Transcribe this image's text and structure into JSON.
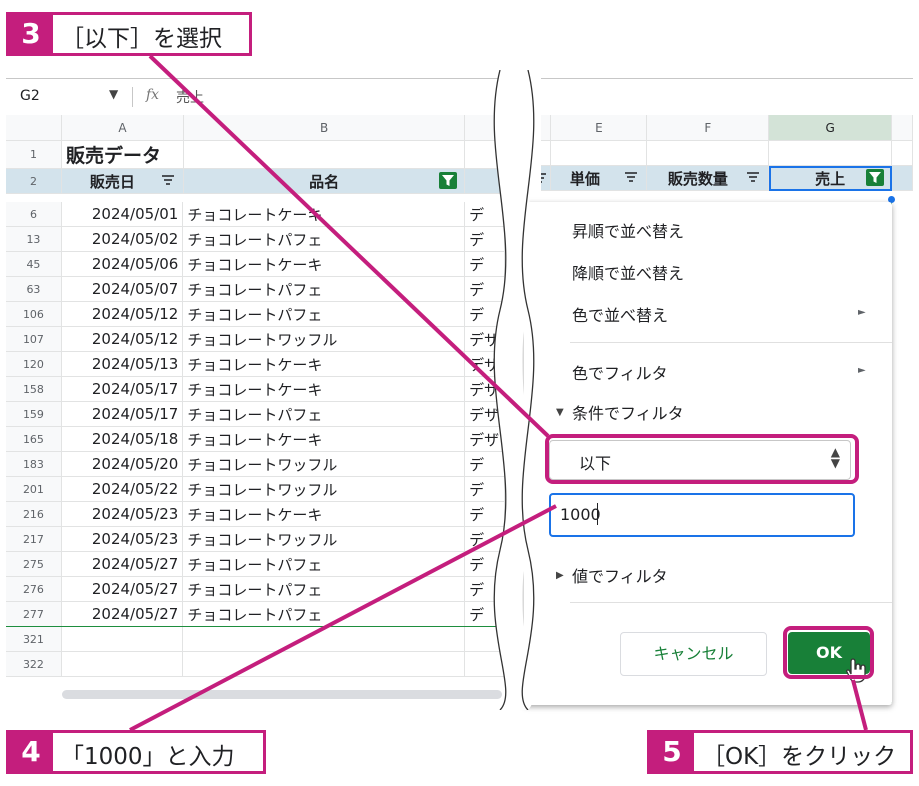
{
  "formula_bar": {
    "cell_ref": "G2",
    "fx": "fx",
    "value": "売上"
  },
  "columns_left": [
    "A",
    "B"
  ],
  "title_row": {
    "row": "1",
    "title": "販売データ"
  },
  "header_row": {
    "row": "2",
    "sale_date": "販売日",
    "product": "品名"
  },
  "rows": [
    {
      "row": "6",
      "date": "2024/05/01",
      "name": "チョコレートケーキ",
      "cat": "デ"
    },
    {
      "row": "13",
      "date": "2024/05/02",
      "name": "チョコレートパフェ",
      "cat": "デ"
    },
    {
      "row": "45",
      "date": "2024/05/06",
      "name": "チョコレートケーキ",
      "cat": "デ"
    },
    {
      "row": "63",
      "date": "2024/05/07",
      "name": "チョコレートパフェ",
      "cat": "デ"
    },
    {
      "row": "106",
      "date": "2024/05/12",
      "name": "チョコレートパフェ",
      "cat": "デ"
    },
    {
      "row": "107",
      "date": "2024/05/12",
      "name": "チョコレートワッフル",
      "cat": "デザ"
    },
    {
      "row": "120",
      "date": "2024/05/13",
      "name": "チョコレートケーキ",
      "cat": "デザ"
    },
    {
      "row": "158",
      "date": "2024/05/17",
      "name": "チョコレートケーキ",
      "cat": "デザ"
    },
    {
      "row": "159",
      "date": "2024/05/17",
      "name": "チョコレートパフェ",
      "cat": "デザ"
    },
    {
      "row": "165",
      "date": "2024/05/18",
      "name": "チョコレートケーキ",
      "cat": "デザ"
    },
    {
      "row": "183",
      "date": "2024/05/20",
      "name": "チョコレートワッフル",
      "cat": "デ"
    },
    {
      "row": "201",
      "date": "2024/05/22",
      "name": "チョコレートワッフル",
      "cat": "デ"
    },
    {
      "row": "216",
      "date": "2024/05/23",
      "name": "チョコレートケーキ",
      "cat": "デ"
    },
    {
      "row": "217",
      "date": "2024/05/23",
      "name": "チョコレートワッフル",
      "cat": "デ"
    },
    {
      "row": "275",
      "date": "2024/05/27",
      "name": "チョコレートパフェ",
      "cat": "デ"
    },
    {
      "row": "276",
      "date": "2024/05/27",
      "name": "チョコレートパフェ",
      "cat": "デ"
    },
    {
      "row": "277",
      "date": "2024/05/27",
      "name": "チョコレートパフェ",
      "cat": "デ"
    }
  ],
  "empty_rows": [
    "321",
    "322"
  ],
  "columns_right": [
    "E",
    "F",
    "G"
  ],
  "header_right": {
    "price": "単価",
    "qty": "販売数量",
    "sales": "売上"
  },
  "menu": {
    "sort_asc": "昇順で並べ替え",
    "sort_desc": "降順で並べ替え",
    "sort_color": "色で並べ替え",
    "filter_color": "色でフィルタ",
    "filter_condition": "条件でフィルタ",
    "condition_value": "以下",
    "input_value": "1000",
    "filter_values": "値でフィルタ",
    "cancel": "キャンセル",
    "ok": "OK"
  },
  "callouts": [
    {
      "num": "3",
      "text": "［以下］を選択"
    },
    {
      "num": "4",
      "text": "「1000」と入力"
    },
    {
      "num": "5",
      "text": "［OK］をクリック"
    }
  ],
  "colors": {
    "accent": "#c41e7d",
    "green": "#188038",
    "blue": "#1a73e8",
    "header_fill": "#d3e3ec"
  }
}
